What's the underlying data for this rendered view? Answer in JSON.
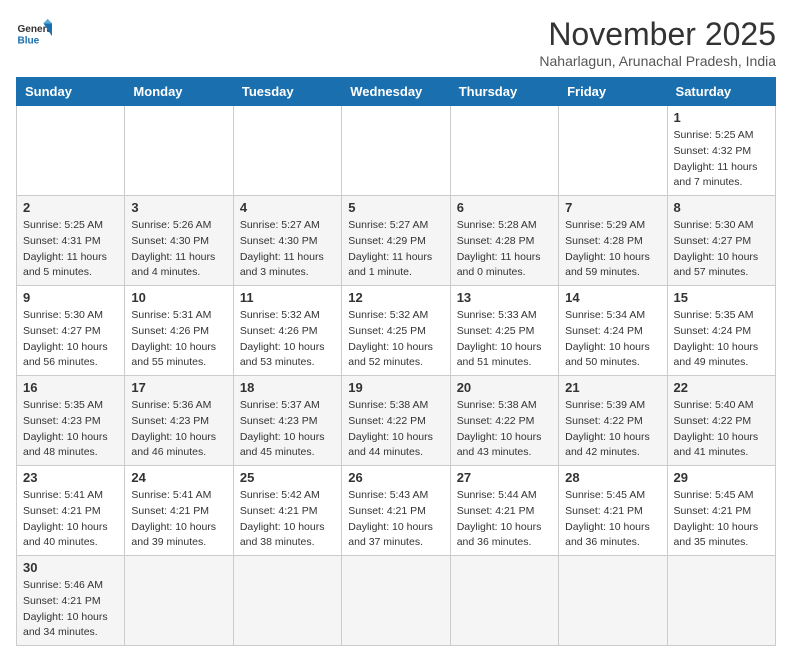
{
  "logo": {
    "line1": "General",
    "line2": "Blue"
  },
  "title": "November 2025",
  "subtitle": "Naharlagun, Arunachal Pradesh, India",
  "weekdays": [
    "Sunday",
    "Monday",
    "Tuesday",
    "Wednesday",
    "Thursday",
    "Friday",
    "Saturday"
  ],
  "weeks": [
    [
      {
        "day": "",
        "info": ""
      },
      {
        "day": "",
        "info": ""
      },
      {
        "day": "",
        "info": ""
      },
      {
        "day": "",
        "info": ""
      },
      {
        "day": "",
        "info": ""
      },
      {
        "day": "",
        "info": ""
      },
      {
        "day": "1",
        "info": "Sunrise: 5:25 AM\nSunset: 4:32 PM\nDaylight: 11 hours\nand 7 minutes."
      }
    ],
    [
      {
        "day": "2",
        "info": "Sunrise: 5:25 AM\nSunset: 4:31 PM\nDaylight: 11 hours\nand 5 minutes."
      },
      {
        "day": "3",
        "info": "Sunrise: 5:26 AM\nSunset: 4:30 PM\nDaylight: 11 hours\nand 4 minutes."
      },
      {
        "day": "4",
        "info": "Sunrise: 5:27 AM\nSunset: 4:30 PM\nDaylight: 11 hours\nand 3 minutes."
      },
      {
        "day": "5",
        "info": "Sunrise: 5:27 AM\nSunset: 4:29 PM\nDaylight: 11 hours\nand 1 minute."
      },
      {
        "day": "6",
        "info": "Sunrise: 5:28 AM\nSunset: 4:28 PM\nDaylight: 11 hours\nand 0 minutes."
      },
      {
        "day": "7",
        "info": "Sunrise: 5:29 AM\nSunset: 4:28 PM\nDaylight: 10 hours\nand 59 minutes."
      },
      {
        "day": "8",
        "info": "Sunrise: 5:30 AM\nSunset: 4:27 PM\nDaylight: 10 hours\nand 57 minutes."
      }
    ],
    [
      {
        "day": "9",
        "info": "Sunrise: 5:30 AM\nSunset: 4:27 PM\nDaylight: 10 hours\nand 56 minutes."
      },
      {
        "day": "10",
        "info": "Sunrise: 5:31 AM\nSunset: 4:26 PM\nDaylight: 10 hours\nand 55 minutes."
      },
      {
        "day": "11",
        "info": "Sunrise: 5:32 AM\nSunset: 4:26 PM\nDaylight: 10 hours\nand 53 minutes."
      },
      {
        "day": "12",
        "info": "Sunrise: 5:32 AM\nSunset: 4:25 PM\nDaylight: 10 hours\nand 52 minutes."
      },
      {
        "day": "13",
        "info": "Sunrise: 5:33 AM\nSunset: 4:25 PM\nDaylight: 10 hours\nand 51 minutes."
      },
      {
        "day": "14",
        "info": "Sunrise: 5:34 AM\nSunset: 4:24 PM\nDaylight: 10 hours\nand 50 minutes."
      },
      {
        "day": "15",
        "info": "Sunrise: 5:35 AM\nSunset: 4:24 PM\nDaylight: 10 hours\nand 49 minutes."
      }
    ],
    [
      {
        "day": "16",
        "info": "Sunrise: 5:35 AM\nSunset: 4:23 PM\nDaylight: 10 hours\nand 48 minutes."
      },
      {
        "day": "17",
        "info": "Sunrise: 5:36 AM\nSunset: 4:23 PM\nDaylight: 10 hours\nand 46 minutes."
      },
      {
        "day": "18",
        "info": "Sunrise: 5:37 AM\nSunset: 4:23 PM\nDaylight: 10 hours\nand 45 minutes."
      },
      {
        "day": "19",
        "info": "Sunrise: 5:38 AM\nSunset: 4:22 PM\nDaylight: 10 hours\nand 44 minutes."
      },
      {
        "day": "20",
        "info": "Sunrise: 5:38 AM\nSunset: 4:22 PM\nDaylight: 10 hours\nand 43 minutes."
      },
      {
        "day": "21",
        "info": "Sunrise: 5:39 AM\nSunset: 4:22 PM\nDaylight: 10 hours\nand 42 minutes."
      },
      {
        "day": "22",
        "info": "Sunrise: 5:40 AM\nSunset: 4:22 PM\nDaylight: 10 hours\nand 41 minutes."
      }
    ],
    [
      {
        "day": "23",
        "info": "Sunrise: 5:41 AM\nSunset: 4:21 PM\nDaylight: 10 hours\nand 40 minutes."
      },
      {
        "day": "24",
        "info": "Sunrise: 5:41 AM\nSunset: 4:21 PM\nDaylight: 10 hours\nand 39 minutes."
      },
      {
        "day": "25",
        "info": "Sunrise: 5:42 AM\nSunset: 4:21 PM\nDaylight: 10 hours\nand 38 minutes."
      },
      {
        "day": "26",
        "info": "Sunrise: 5:43 AM\nSunset: 4:21 PM\nDaylight: 10 hours\nand 37 minutes."
      },
      {
        "day": "27",
        "info": "Sunrise: 5:44 AM\nSunset: 4:21 PM\nDaylight: 10 hours\nand 36 minutes."
      },
      {
        "day": "28",
        "info": "Sunrise: 5:45 AM\nSunset: 4:21 PM\nDaylight: 10 hours\nand 36 minutes."
      },
      {
        "day": "29",
        "info": "Sunrise: 5:45 AM\nSunset: 4:21 PM\nDaylight: 10 hours\nand 35 minutes."
      }
    ],
    [
      {
        "day": "30",
        "info": "Sunrise: 5:46 AM\nSunset: 4:21 PM\nDaylight: 10 hours\nand 34 minutes."
      },
      {
        "day": "",
        "info": ""
      },
      {
        "day": "",
        "info": ""
      },
      {
        "day": "",
        "info": ""
      },
      {
        "day": "",
        "info": ""
      },
      {
        "day": "",
        "info": ""
      },
      {
        "day": "",
        "info": ""
      }
    ]
  ]
}
